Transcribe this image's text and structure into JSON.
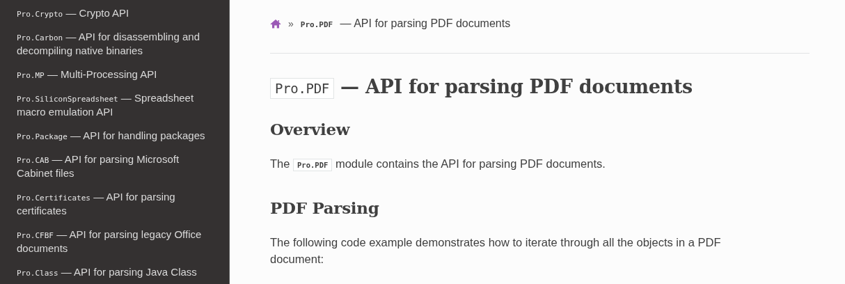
{
  "sidebar": {
    "items": [
      {
        "code": "Pro.Crypto",
        "text": "— Crypto API"
      },
      {
        "code": "Pro.Carbon",
        "text": "— API for disassembling and decompiling native binaries"
      },
      {
        "code": "Pro.MP",
        "text": "— Multi-Processing API"
      },
      {
        "code": "Pro.SiliconSpreadsheet",
        "text": "— Spreadsheet macro emulation API"
      },
      {
        "code": "Pro.Package",
        "text": "— API for handling packages"
      },
      {
        "code": "Pro.CAB",
        "text": "— API for parsing Microsoft Cabinet files"
      },
      {
        "code": "Pro.Certificates",
        "text": "— API for parsing certificates"
      },
      {
        "code": "Pro.CFBF",
        "text": "— API for parsing legacy Office documents"
      },
      {
        "code": "Pro.Class",
        "text": "— API for parsing Java Class"
      }
    ]
  },
  "breadcrumb": {
    "separator": "»",
    "code": "Pro.PDF",
    "text": "— API for parsing PDF documents"
  },
  "title": {
    "code": "Pro.PDF",
    "text": "— API for parsing PDF documents"
  },
  "sections": [
    {
      "heading": "Overview",
      "paragraphs": [
        {
          "before": "The",
          "code": "Pro.PDF",
          "after": "module contains the API for parsing PDF documents."
        }
      ]
    },
    {
      "heading": "PDF Parsing",
      "paragraphs": [
        {
          "before": "The following code example demonstrates how to iterate through all the objects in a PDF document:"
        }
      ]
    }
  ]
}
